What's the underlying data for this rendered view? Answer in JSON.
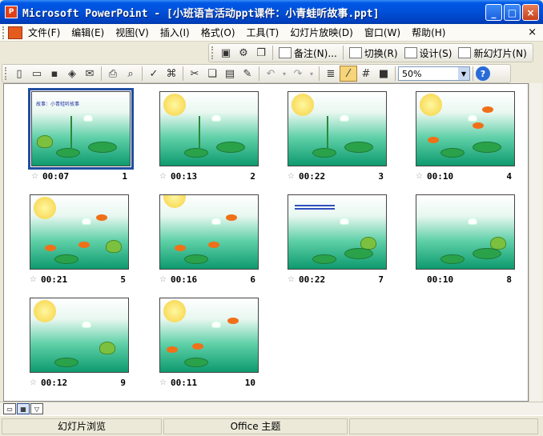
{
  "window": {
    "app_icon_text": "P",
    "title": "Microsoft PowerPoint - [小班语言活动ppt课件：小青蛙听故事.ppt]",
    "minimize": "_",
    "maximize": "□",
    "close": "×"
  },
  "menubar": {
    "items": [
      "文件(F)",
      "编辑(E)",
      "视图(V)",
      "插入(I)",
      "格式(O)",
      "工具(T)",
      "幻灯片放映(D)",
      "窗口(W)",
      "帮助(H)"
    ],
    "close_glyph": "×"
  },
  "toolbar_sorter": {
    "notes": "备注(N)...",
    "transition": "切换(R)",
    "design": "设计(S)",
    "new_slide": "新幻灯片(N)"
  },
  "toolbar_standard": {
    "zoom": "50%",
    "help": "?"
  },
  "slides": [
    {
      "time": "00:07",
      "number": "1",
      "selected": true,
      "title_text": "故事：小青蛙听故事"
    },
    {
      "time": "00:13",
      "number": "2"
    },
    {
      "time": "00:22",
      "number": "3"
    },
    {
      "time": "00:10",
      "number": "4"
    },
    {
      "time": "00:21",
      "number": "5"
    },
    {
      "time": "00:16",
      "number": "6"
    },
    {
      "time": "00:22",
      "number": "7"
    },
    {
      "time": "00:10",
      "number": "8"
    },
    {
      "time": "00:12",
      "number": "9"
    },
    {
      "time": "00:11",
      "number": "10"
    }
  ],
  "statusbar": {
    "view": "幻灯片浏览",
    "theme": "Office 主题"
  },
  "colors": {
    "titlebar": "#0050d8",
    "selection": "#1f4ea0"
  }
}
